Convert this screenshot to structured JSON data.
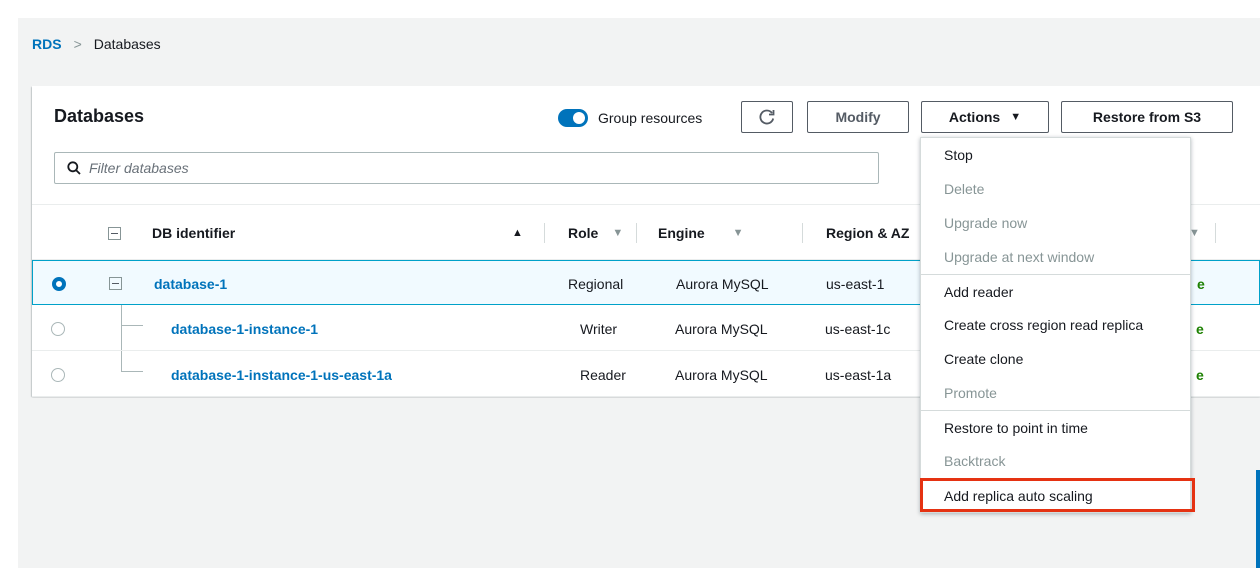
{
  "breadcrumb": {
    "root": "RDS",
    "current": "Databases"
  },
  "panel": {
    "title": "Databases",
    "group_toggle_label": "Group resources",
    "group_toggle_on": true,
    "buttons": {
      "refresh_icon": "refresh-icon",
      "modify": "Modify",
      "actions": "Actions",
      "restore": "Restore from S3"
    },
    "filter_placeholder": "Filter databases"
  },
  "table": {
    "columns": [
      "DB identifier",
      "Role",
      "Engine",
      "Region & AZ"
    ],
    "rows": [
      {
        "id": "database-1",
        "role": "Regional",
        "engine": "Aurora MySQL",
        "region": "us-east-1",
        "selected": true
      },
      {
        "id": "database-1-instance-1",
        "role": "Writer",
        "engine": "Aurora MySQL",
        "region": "us-east-1c",
        "selected": false
      },
      {
        "id": "database-1-instance-1-us-east-1a",
        "role": "Reader",
        "engine": "Aurora MySQL",
        "region": "us-east-1a",
        "selected": false
      }
    ],
    "status_fragment": "e"
  },
  "actions_menu": {
    "items": [
      {
        "label": "Stop",
        "disabled": false
      },
      {
        "label": "Delete",
        "disabled": true
      },
      {
        "label": "Upgrade now",
        "disabled": true
      },
      {
        "label": "Upgrade at next window",
        "disabled": true
      },
      {
        "label": "Add reader",
        "disabled": false
      },
      {
        "label": "Create cross region read replica",
        "disabled": false
      },
      {
        "label": "Create clone",
        "disabled": false
      },
      {
        "label": "Promote",
        "disabled": true
      },
      {
        "label": "Restore to point in time",
        "disabled": false
      },
      {
        "label": "Backtrack",
        "disabled": true
      },
      {
        "label": "Add replica auto scaling",
        "disabled": false,
        "highlighted": true
      }
    ]
  },
  "colors": {
    "accent": "#0073bb",
    "highlight_border": "#e53212",
    "status_green": "#1d8102"
  }
}
